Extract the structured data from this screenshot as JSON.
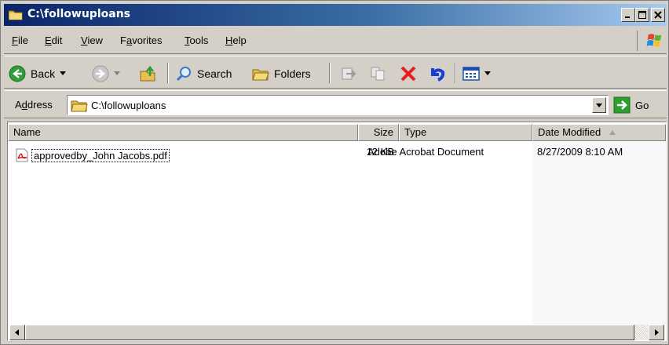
{
  "window": {
    "title": "C:\\followuploans"
  },
  "menu": {
    "items": [
      "File",
      "Edit",
      "View",
      "Favorites",
      "Tools",
      "Help"
    ],
    "underline_chars": [
      "F",
      "E",
      "V",
      "a",
      "T",
      "H"
    ]
  },
  "toolbar": {
    "back_label": "Back",
    "search_label": "Search",
    "folders_label": "Folders"
  },
  "address": {
    "label": "Address",
    "label_underline": "d",
    "value": "C:\\followuploans",
    "go_label": "Go"
  },
  "list": {
    "columns": [
      "Name",
      "Size",
      "Type",
      "Date Modified"
    ],
    "sorted_column": "Date Modified",
    "rows": [
      {
        "name": "approvedby_John Jacobs.pdf",
        "size": "12 KB",
        "type": "Adobe Acrobat Document",
        "date_modified": "8/27/2009 8:10 AM",
        "icon": "pdf-file-icon"
      }
    ]
  },
  "colors": {
    "titlebar_start": "#0a246a",
    "titlebar_end": "#a6caf0",
    "chrome": "#d4d0c8",
    "close_x": "#e81e1e",
    "go_green": "#2e9e2e"
  }
}
